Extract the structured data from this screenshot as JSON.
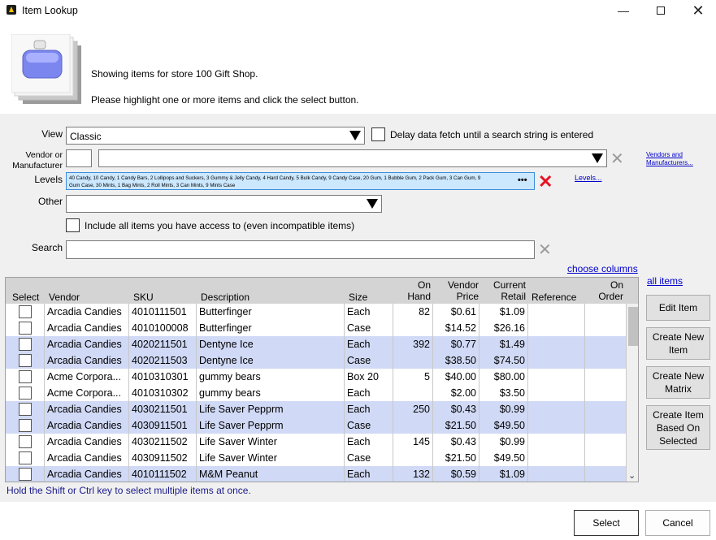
{
  "window": {
    "title": "Item Lookup",
    "minimize_icon": "minimize-icon",
    "maximize_icon": "maximize-icon",
    "close_icon": "close-icon"
  },
  "header": {
    "store_text": "Showing items for store 100 Gift Shop.",
    "instruction": "Please highlight one or more items and click the select button."
  },
  "filters": {
    "view_label": "View",
    "view_value": "Classic",
    "delay_label": "Delay data fetch until a search string is entered",
    "vendor_label_line1": "Vendor or",
    "vendor_label_line2": "Manufacturer",
    "vendor_code": "",
    "vendor_value": "",
    "vendors_link_line1": "Vendors and",
    "vendors_link_line2": "Manufacturers...",
    "levels_label": "Levels",
    "levels_line1": "40 Candy, 10 Candy, 1 Candy Bars, 2 Lollipops and Suckers, 3 Gummy & Jelly Candy, 4 Hard Candy, 5 Bulk Candy, 9 Candy Case, 20 Gum, 1 Bubble Gum, 2 Pack Gum, 3 Can Gum, 9",
    "levels_line2": "Gum Case, 30 Mints, 1 Bag Mints, 2 Roll Mints, 3 Can Mints, 9 Mints Case",
    "levels_more": "•••",
    "levels_link": "Levels...",
    "other_label": "Other",
    "other_value": "",
    "include_all_label": "Include all items you have access to (even incompatible items)",
    "search_label": "Search",
    "search_value": "",
    "choose_columns": "choose columns",
    "all_items": "all items"
  },
  "grid": {
    "headers": {
      "select": "Select",
      "vendor": "Vendor",
      "sku": "SKU",
      "description": "Description",
      "size": "Size",
      "on_hand_1": "On",
      "on_hand_2": "Hand",
      "vendor_price_1": "Vendor",
      "vendor_price_2": "Price",
      "current_retail_1": "Current",
      "current_retail_2": "Retail",
      "reference": "Reference",
      "on_order_1": "On",
      "on_order_2": "Order"
    },
    "rows": [
      {
        "vendor": "Arcadia Candies",
        "sku": "4010111501",
        "description": "Butterfinger",
        "size": "Each",
        "on_hand": "82",
        "vendor_price": "$0.61",
        "retail": "$1.09",
        "reference": "",
        "on_order": "",
        "highlight": false
      },
      {
        "vendor": "Arcadia Candies",
        "sku": "4010100008",
        "description": "Butterfinger",
        "size": "Case",
        "on_hand": "",
        "vendor_price": "$14.52",
        "retail": "$26.16",
        "reference": "",
        "on_order": "",
        "highlight": false
      },
      {
        "vendor": "Arcadia Candies",
        "sku": "4020211501",
        "description": "Dentyne Ice",
        "size": "Each",
        "on_hand": "392",
        "vendor_price": "$0.77",
        "retail": "$1.49",
        "reference": "",
        "on_order": "",
        "highlight": true
      },
      {
        "vendor": "Arcadia Candies",
        "sku": "4020211503",
        "description": "Dentyne Ice",
        "size": "Case",
        "on_hand": "",
        "vendor_price": "$38.50",
        "retail": "$74.50",
        "reference": "",
        "on_order": "",
        "highlight": true
      },
      {
        "vendor": "Acme Corpora...",
        "sku": "4010310301",
        "description": "gummy bears",
        "size": "Box 20",
        "on_hand": "5",
        "vendor_price": "$40.00",
        "retail": "$80.00",
        "reference": "",
        "on_order": "",
        "highlight": false
      },
      {
        "vendor": "Acme Corpora...",
        "sku": "4010310302",
        "description": "gummy bears",
        "size": "Each",
        "on_hand": "",
        "vendor_price": "$2.00",
        "retail": "$3.50",
        "reference": "",
        "on_order": "",
        "highlight": false
      },
      {
        "vendor": "Arcadia Candies",
        "sku": "4030211501",
        "description": "Life Saver Pepprm",
        "size": "Each",
        "on_hand": "250",
        "vendor_price": "$0.43",
        "retail": "$0.99",
        "reference": "",
        "on_order": "",
        "highlight": true
      },
      {
        "vendor": "Arcadia Candies",
        "sku": "4030911501",
        "description": "Life Saver Pepprm",
        "size": "Case",
        "on_hand": "",
        "vendor_price": "$21.50",
        "retail": "$49.50",
        "reference": "",
        "on_order": "",
        "highlight": true
      },
      {
        "vendor": "Arcadia Candies",
        "sku": "4030211502",
        "description": "Life Saver Winter",
        "size": "Each",
        "on_hand": "145",
        "vendor_price": "$0.43",
        "retail": "$0.99",
        "reference": "",
        "on_order": "",
        "highlight": false
      },
      {
        "vendor": "Arcadia Candies",
        "sku": "4030911502",
        "description": "Life Saver Winter",
        "size": "Case",
        "on_hand": "",
        "vendor_price": "$21.50",
        "retail": "$49.50",
        "reference": "",
        "on_order": "",
        "highlight": false
      },
      {
        "vendor": "Arcadia Candies",
        "sku": "4010111502",
        "description": "M&M Peanut",
        "size": "Each",
        "on_hand": "132",
        "vendor_price": "$0.59",
        "retail": "$1.09",
        "reference": "",
        "on_order": "",
        "highlight": true
      }
    ]
  },
  "side_buttons": {
    "edit_item": "Edit Item",
    "create_new_item_1": "Create New",
    "create_new_item_2": "Item",
    "create_new_matrix_1": "Create New",
    "create_new_matrix_2": "Matrix",
    "create_item_based_1": "Create Item",
    "create_item_based_2": "Based On",
    "create_item_based_3": "Selected"
  },
  "hint": "Hold the Shift or Ctrl key to select multiple items at once.",
  "footer": {
    "select_label": "Select",
    "cancel_label": "Cancel"
  },
  "colors": {
    "highlight_row": "#d0d9f5",
    "link": "#0000cc",
    "hint_text": "#1a1a8c",
    "levels_bg": "#cce8ff"
  }
}
